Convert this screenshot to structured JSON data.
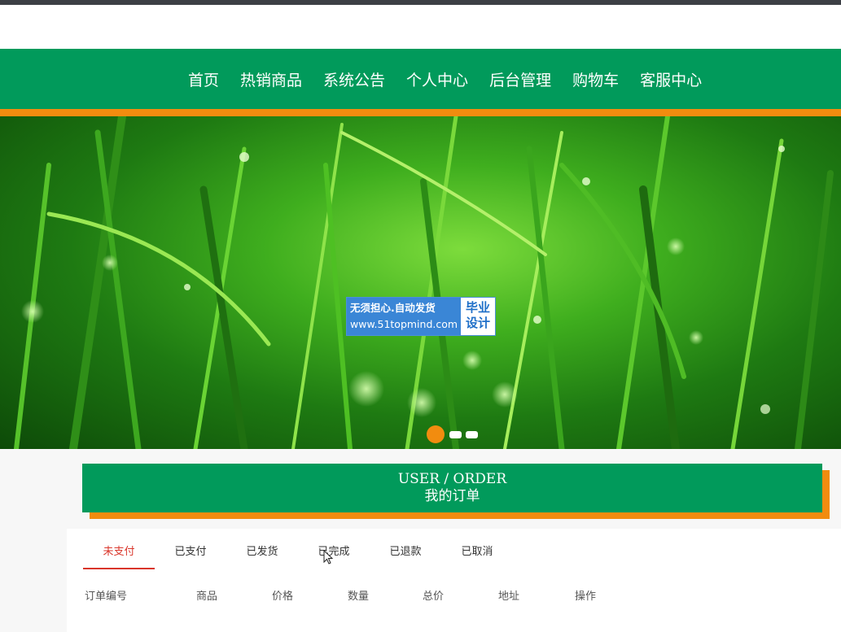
{
  "nav": {
    "items": [
      {
        "label": "首页"
      },
      {
        "label": "热销商品"
      },
      {
        "label": "系统公告"
      },
      {
        "label": "个人中心"
      },
      {
        "label": "后台管理"
      },
      {
        "label": "购物车"
      },
      {
        "label": "客服中心"
      }
    ],
    "colors": {
      "bar": "#019a5b",
      "accent": "#f28c0f"
    }
  },
  "banner": {
    "watermark": {
      "line1": "无须担心.自动发货",
      "line2": "www.51topmind.com",
      "right_line1": "毕业",
      "right_line2": "设计"
    },
    "slides_total": 3,
    "active_slide": 1
  },
  "section": {
    "title_en": "USER / ORDER",
    "title_cn": "我的订单"
  },
  "order_tabs": [
    {
      "label": "未支付",
      "active": true
    },
    {
      "label": "已支付"
    },
    {
      "label": "已发货"
    },
    {
      "label": "已完成"
    },
    {
      "label": "已退款"
    },
    {
      "label": "已取消"
    }
  ],
  "table": {
    "columns": [
      "订单编号",
      "商品",
      "价格",
      "数量",
      "总价",
      "地址",
      "操作"
    ]
  }
}
